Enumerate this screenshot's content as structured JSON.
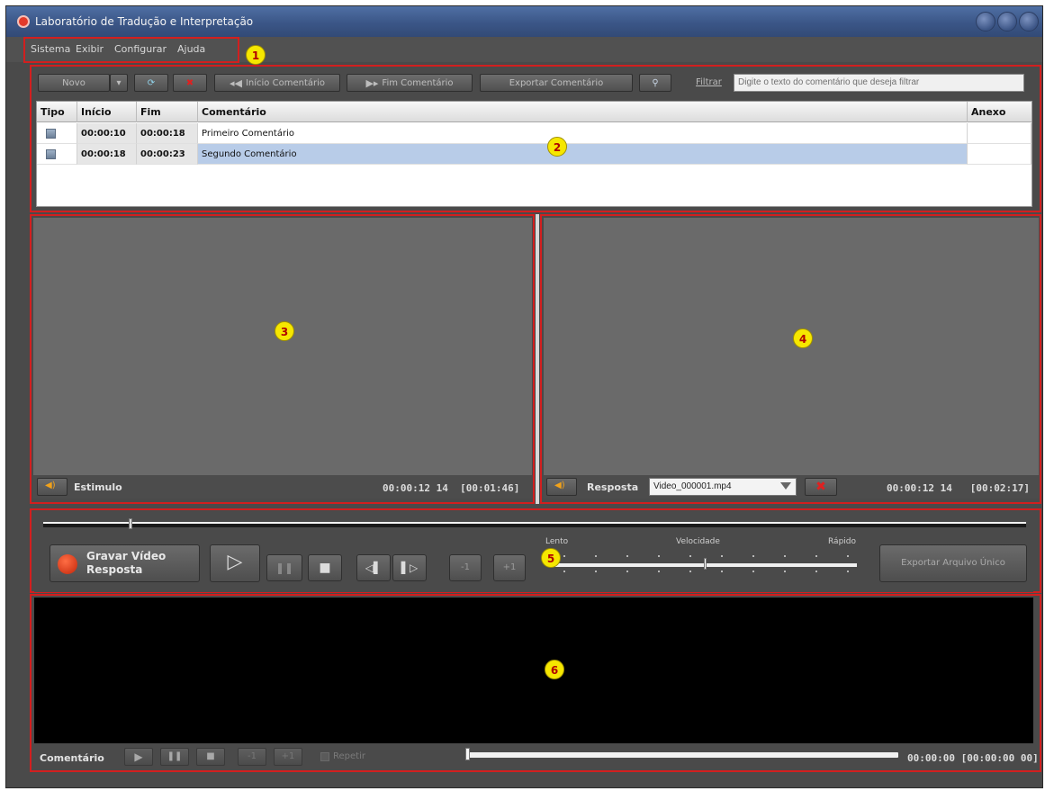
{
  "window": {
    "title": "Laboratório de Tradução e Interpretação"
  },
  "menu": {
    "items": [
      "Sistema",
      "Exibir",
      "Configurar",
      "Ajuda"
    ]
  },
  "badges": [
    "1",
    "2",
    "3",
    "4",
    "5",
    "6"
  ],
  "toolbar": {
    "new_label": "Novo",
    "inicio_comentario": "Início Comentário",
    "fim_comentario": "Fim Comentário",
    "exportar_comentario": "Exportar Comentário",
    "filter_label": "Filtrar",
    "filter_placeholder": "Digite o texto do comentário que deseja filtrar"
  },
  "table": {
    "columns": [
      "Tipo",
      "Início",
      "Fim",
      "Comentário",
      "Anexo"
    ],
    "rows": [
      {
        "inicio": "00:00:10",
        "fim": "00:00:18",
        "comentario": "Primeiro Comentário",
        "anexo": ""
      },
      {
        "inicio": "00:00:18",
        "fim": "00:00:23",
        "comentario": "Segundo Comentário",
        "anexo": ""
      }
    ]
  },
  "stimulus": {
    "label": "Estimulo",
    "timecode": "00:00:12 14  [00:01:46]"
  },
  "response": {
    "label": "Resposta",
    "file": "Video_000001.mp4",
    "timecode": "00:00:12 14   [00:02:17]"
  },
  "controls": {
    "record_label": "Gravar Vídeo Resposta",
    "minus_one": "-1",
    "plus_one": "+1",
    "speed_slow": "Lento",
    "speed_title": "Velocidade",
    "speed_fast": "Rápido",
    "speed_level": 0.5,
    "export_single": "Exportar Arquivo Único"
  },
  "comment_bar": {
    "label": "Comentário",
    "minus_one": "-1",
    "plus_one": "+1",
    "repeat_label": "Repetir",
    "timecode": "00:00:00 [00:00:00 00]"
  },
  "colors": {
    "annotation_border": "#d21f1f",
    "badge_fill": "#f6e700",
    "selected_row": "#b8cce8"
  },
  "icons": [
    "app-logo-icon",
    "dropdown-arrow-icon",
    "refresh-icon",
    "delete-icon",
    "mark-start-icon",
    "mark-end-icon",
    "zoom-icon",
    "speaker-icon",
    "record-icon",
    "play-icon",
    "pause-icon",
    "stop-icon",
    "step-back-icon",
    "step-forward-icon"
  ]
}
